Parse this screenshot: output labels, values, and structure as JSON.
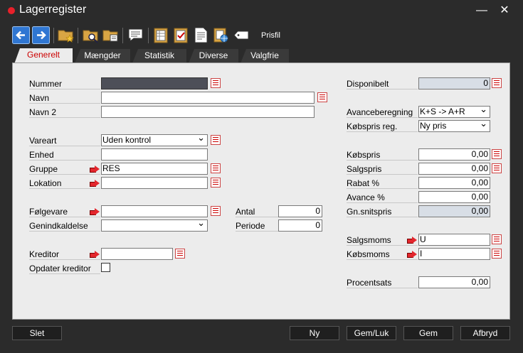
{
  "window": {
    "title": "Lagerregister",
    "minimize": "—",
    "close": "✕"
  },
  "toolbar": {
    "prisfil_label": "Prisfil"
  },
  "tabs": [
    "Generelt",
    "Mængder",
    "Statistik",
    "Diverse",
    "Valgfrie"
  ],
  "left": {
    "nummer_label": "Nummer",
    "nummer_value": "",
    "navn_label": "Navn",
    "navn_value": "",
    "navn2_label": "Navn 2",
    "navn2_value": "",
    "vareart_label": "Vareart",
    "vareart_value": "Uden kontrol",
    "enhed_label": "Enhed",
    "enhed_value": "",
    "gruppe_label": "Gruppe",
    "gruppe_value": "RES",
    "lokation_label": "Lokation",
    "lokation_value": "",
    "folgevare_label": "Følgevare",
    "folgevare_value": "",
    "genind_label": "Genindkaldelse",
    "genind_value": "",
    "antal_label": "Antal",
    "antal_value": "0",
    "periode_label": "Periode",
    "periode_value": "0",
    "kreditor_label": "Kreditor",
    "kreditor_value": "",
    "opdater_label": "Opdater kreditor"
  },
  "right": {
    "disponibelt_label": "Disponibelt",
    "disponibelt_value": "0",
    "avance_label": "Avanceberegning",
    "avance_value": "K+S -> A+R",
    "kobspris_reg_label": "Købspris reg.",
    "kobspris_reg_value": "Ny pris",
    "kobspris_label": "Købspris",
    "kobspris_value": "0,00",
    "salgspris_label": "Salgspris",
    "salgspris_value": "0,00",
    "rabat_label": "Rabat %",
    "rabat_value": "0,00",
    "avancepct_label": "Avance %",
    "avancepct_value": "0,00",
    "gnsnit_label": "Gn.snitspris",
    "gnsnit_value": "0,00",
    "salgsmoms_label": "Salgsmoms",
    "salgsmoms_value": "U",
    "kobsmoms_label": "Købsmoms",
    "kobsmoms_value": "I",
    "procentsats_label": "Procentsats",
    "procentsats_value": "0,00"
  },
  "buttons": {
    "slet": "Slet",
    "ny": "Ny",
    "gemluk": "Gem/Luk",
    "gem": "Gem",
    "afbryd": "Afbryd"
  },
  "colors": {
    "accent_red": "#e8202a",
    "tab_active_text": "#cc0000",
    "panel_bg": "#ececec",
    "toolbar_blue": "#2f76d2"
  }
}
